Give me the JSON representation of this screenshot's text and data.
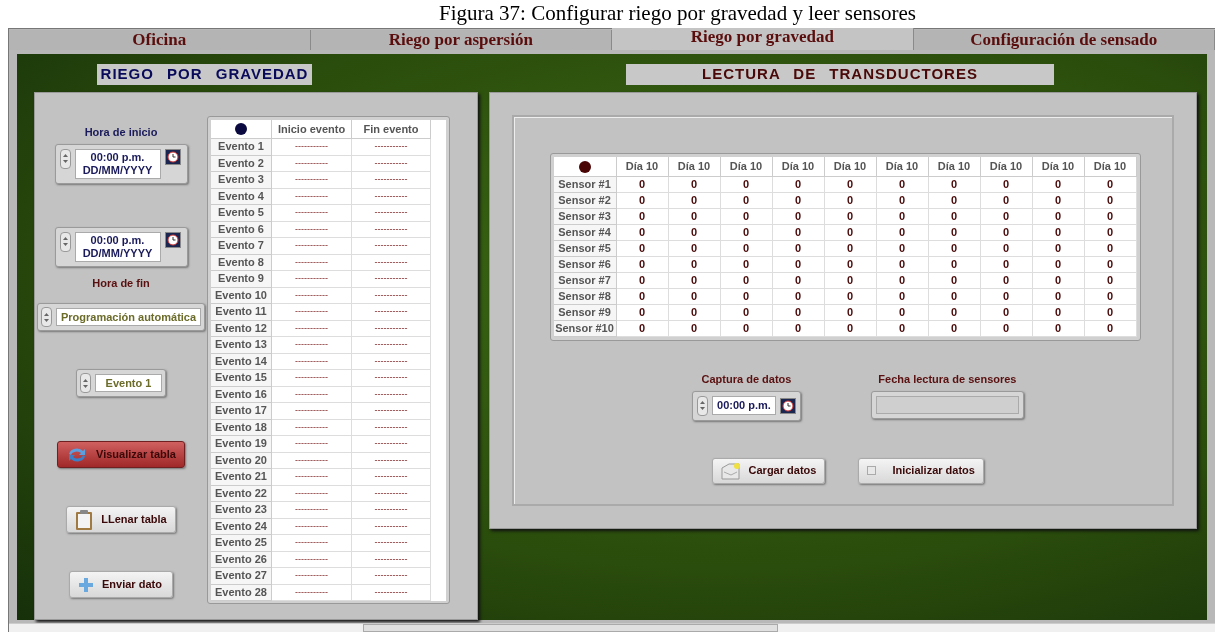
{
  "caption": "Figura 37: Configurar riego por gravedad y leer sensores",
  "tabs": [
    {
      "label": "Oficina",
      "selected": false
    },
    {
      "label": "Riego por aspersión",
      "selected": false
    },
    {
      "label": "Riego por gravedad",
      "selected": true
    },
    {
      "label": "Configuración de sensado",
      "selected": false
    }
  ],
  "left": {
    "title": "RIEGO POR GRAVEDAD",
    "start": {
      "label": "Hora de inicio",
      "time": "00:00 p.m.",
      "date": "DD/MM/YYYY"
    },
    "end": {
      "label": "Hora de fin",
      "time": "00:00 p.m.",
      "date": "DD/MM/YYYY"
    },
    "mode": "Programación automática",
    "event": "Evento 1",
    "buttons": [
      {
        "label": "Visualizar tabla",
        "kind": "refresh",
        "active": true
      },
      {
        "label": "LLenar tabla",
        "kind": "clipboard",
        "active": false
      },
      {
        "label": "Enviar dato",
        "kind": "plus",
        "active": false
      }
    ],
    "table": {
      "columns": [
        "Inicio evento",
        "Fin evento"
      ],
      "rows": [
        {
          "label": "Evento 1",
          "cells": [
            "-----------",
            "-----------"
          ]
        },
        {
          "label": "Evento 2",
          "cells": [
            "-----------",
            "-----------"
          ]
        },
        {
          "label": "Evento 3",
          "cells": [
            "-----------",
            "-----------"
          ]
        },
        {
          "label": "Evento 4",
          "cells": [
            "-----------",
            "-----------"
          ]
        },
        {
          "label": "Evento 5",
          "cells": [
            "-----------",
            "-----------"
          ]
        },
        {
          "label": "Evento 6",
          "cells": [
            "-----------",
            "-----------"
          ]
        },
        {
          "label": "Evento 7",
          "cells": [
            "-----------",
            "-----------"
          ]
        },
        {
          "label": "Evento 8",
          "cells": [
            "-----------",
            "-----------"
          ]
        },
        {
          "label": "Evento 9",
          "cells": [
            "-----------",
            "-----------"
          ]
        },
        {
          "label": "Evento 10",
          "cells": [
            "-----------",
            "-----------"
          ]
        },
        {
          "label": "Evento 11",
          "cells": [
            "-----------",
            "-----------"
          ]
        },
        {
          "label": "Evento 12",
          "cells": [
            "-----------",
            "-----------"
          ]
        },
        {
          "label": "Evento 13",
          "cells": [
            "-----------",
            "-----------"
          ]
        },
        {
          "label": "Evento 14",
          "cells": [
            "-----------",
            "-----------"
          ]
        },
        {
          "label": "Evento 15",
          "cells": [
            "-----------",
            "-----------"
          ]
        },
        {
          "label": "Evento 16",
          "cells": [
            "-----------",
            "-----------"
          ]
        },
        {
          "label": "Evento 17",
          "cells": [
            "-----------",
            "-----------"
          ]
        },
        {
          "label": "Evento 18",
          "cells": [
            "-----------",
            "-----------"
          ]
        },
        {
          "label": "Evento 19",
          "cells": [
            "-----------",
            "-----------"
          ]
        },
        {
          "label": "Evento 20",
          "cells": [
            "-----------",
            "-----------"
          ]
        },
        {
          "label": "Evento 21",
          "cells": [
            "-----------",
            "-----------"
          ]
        },
        {
          "label": "Evento 22",
          "cells": [
            "-----------",
            "-----------"
          ]
        },
        {
          "label": "Evento 23",
          "cells": [
            "-----------",
            "-----------"
          ]
        },
        {
          "label": "Evento 24",
          "cells": [
            "-----------",
            "-----------"
          ]
        },
        {
          "label": "Evento 25",
          "cells": [
            "-----------",
            "-----------"
          ]
        },
        {
          "label": "Evento 26",
          "cells": [
            "-----------",
            "-----------"
          ]
        },
        {
          "label": "Evento 27",
          "cells": [
            "-----------",
            "-----------"
          ]
        },
        {
          "label": "Evento 28",
          "cells": [
            "-----------",
            "-----------"
          ]
        }
      ]
    }
  },
  "right": {
    "title": "LECTURA DE TRANSDUCTORES",
    "table": {
      "columns": [
        "Día 10",
        "Día 10",
        "Día 10",
        "Día 10",
        "Día 10",
        "Día 10",
        "Día 10",
        "Día 10",
        "Día 10",
        "Día 10"
      ],
      "rows": [
        {
          "label": "Sensor #1",
          "cells": [
            "0",
            "0",
            "0",
            "0",
            "0",
            "0",
            "0",
            "0",
            "0",
            "0"
          ]
        },
        {
          "label": "Sensor #2",
          "cells": [
            "0",
            "0",
            "0",
            "0",
            "0",
            "0",
            "0",
            "0",
            "0",
            "0"
          ]
        },
        {
          "label": "Sensor #3",
          "cells": [
            "0",
            "0",
            "0",
            "0",
            "0",
            "0",
            "0",
            "0",
            "0",
            "0"
          ]
        },
        {
          "label": "Sensor #4",
          "cells": [
            "0",
            "0",
            "0",
            "0",
            "0",
            "0",
            "0",
            "0",
            "0",
            "0"
          ]
        },
        {
          "label": "Sensor #5",
          "cells": [
            "0",
            "0",
            "0",
            "0",
            "0",
            "0",
            "0",
            "0",
            "0",
            "0"
          ]
        },
        {
          "label": "Sensor #6",
          "cells": [
            "0",
            "0",
            "0",
            "0",
            "0",
            "0",
            "0",
            "0",
            "0",
            "0"
          ]
        },
        {
          "label": "Sensor #7",
          "cells": [
            "0",
            "0",
            "0",
            "0",
            "0",
            "0",
            "0",
            "0",
            "0",
            "0"
          ]
        },
        {
          "label": "Sensor #8",
          "cells": [
            "0",
            "0",
            "0",
            "0",
            "0",
            "0",
            "0",
            "0",
            "0",
            "0"
          ]
        },
        {
          "label": "Sensor #9",
          "cells": [
            "0",
            "0",
            "0",
            "0",
            "0",
            "0",
            "0",
            "0",
            "0",
            "0"
          ]
        },
        {
          "label": "Sensor #10",
          "cells": [
            "0",
            "0",
            "0",
            "0",
            "0",
            "0",
            "0",
            "0",
            "0",
            "0"
          ]
        }
      ]
    },
    "capture": {
      "label": "Captura de datos",
      "time": "00:00 p.m."
    },
    "read_date": {
      "label": "Fecha lectura de sensores"
    },
    "load_button": "Cargar datos",
    "init_button": {
      "label": "Inicializar datos",
      "on": false
    }
  }
}
